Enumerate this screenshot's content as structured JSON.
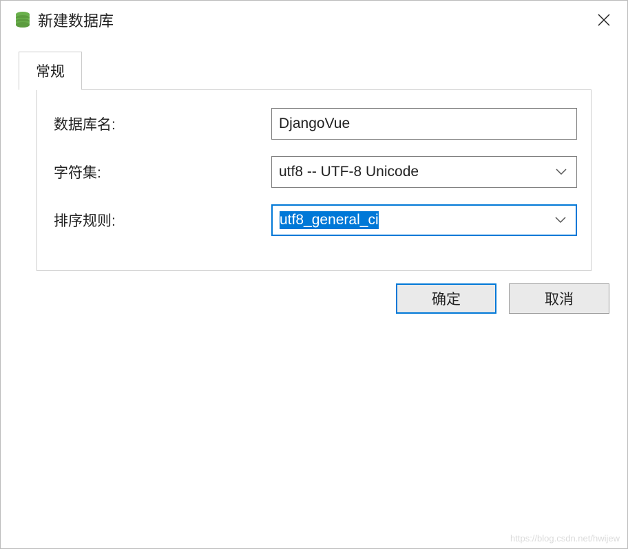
{
  "dialog": {
    "title": "新建数据库",
    "close_icon": "close"
  },
  "tabs": {
    "general": "常规"
  },
  "form": {
    "db_name_label": "数据库名:",
    "db_name_value": "DjangoVue",
    "charset_label": "字符集:",
    "charset_value": "utf8 -- UTF-8 Unicode",
    "collation_label": "排序规则:",
    "collation_value": "utf8_general_ci"
  },
  "buttons": {
    "ok": "确定",
    "cancel": "取消"
  },
  "watermark": "https://blog.csdn.net/hwijew"
}
